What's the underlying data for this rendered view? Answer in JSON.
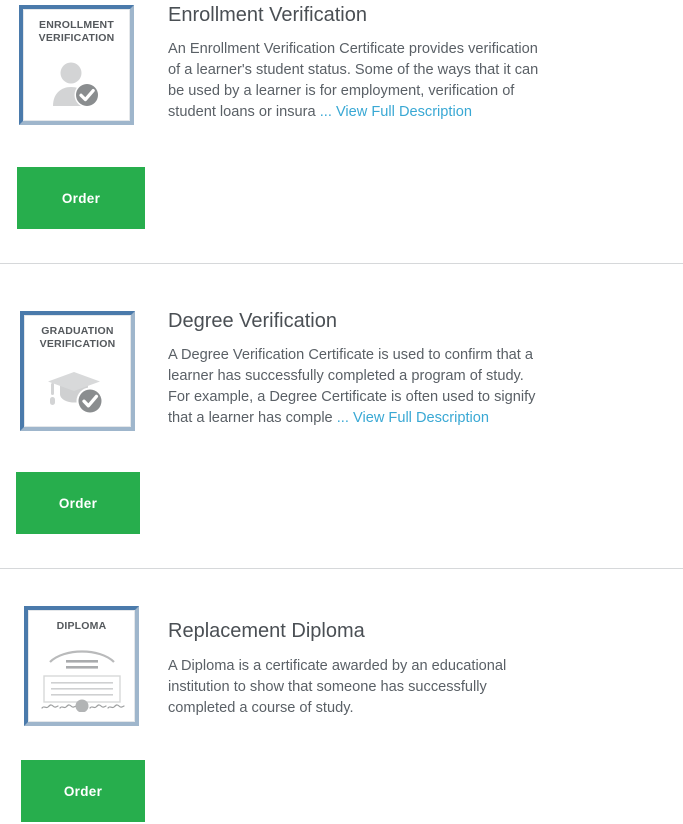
{
  "page": {
    "kind": "credential-order-catalog",
    "background_color": "#ffffff",
    "divider_color": "#d6d8da"
  },
  "theme": {
    "order_button_color": "#27ae4d",
    "order_button_text_color": "#ffffff",
    "link_color": "#39a8d4",
    "title_color": "#4a4f54",
    "body_text_color": "#5a6066",
    "thumb_border_light": "#4a7aab",
    "thumb_border_shadow": "#9fb6cc",
    "thumb_art_fill": "#d3d4d5",
    "thumb_badge_fill": "#8a8d8f"
  },
  "products": [
    {
      "id": "enrollment-verification",
      "title": "Enrollment Verification",
      "description": "An Enrollment Verification Certificate provides verification of a learner's student status. Some of the ways that it can be used by a learner is for employment, verification of student loans or insura",
      "ellipsis": "...",
      "view_full_label": "View Full Description",
      "order_label": "Order",
      "thumbnail": {
        "icon_name": "person-check-icon",
        "caption_lines": [
          "Enrollment",
          "Verification"
        ]
      }
    },
    {
      "id": "degree-verification",
      "title": "Degree Verification",
      "description": "A Degree Verification Certificate is used to confirm that a learner has successfully completed a program of study. For example, a Degree Certificate is often used to signify that a learner has comple",
      "ellipsis": "...",
      "view_full_label": "View Full Description",
      "order_label": "Order",
      "thumbnail": {
        "icon_name": "graduation-cap-check-icon",
        "caption_lines": [
          "Graduation",
          "Verification"
        ]
      }
    },
    {
      "id": "replacement-diploma",
      "title": "Replacement Diploma",
      "description": "A Diploma is a certificate awarded by an educational institution to show that someone has successfully completed a course of study.",
      "ellipsis": "",
      "view_full_label": "",
      "order_label": "Order",
      "thumbnail": {
        "icon_name": "diploma-document-icon",
        "caption_lines": [
          "Diploma"
        ]
      }
    }
  ]
}
